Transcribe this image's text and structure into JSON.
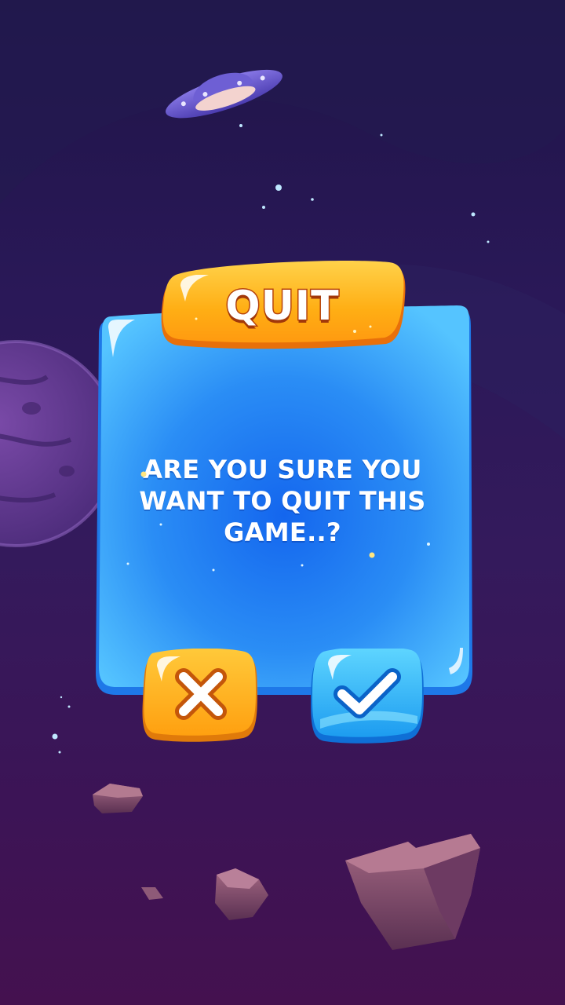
{
  "dialog": {
    "title": "QUIT",
    "message_lines": [
      "ARE YOU SURE YOU",
      "WANT TO QUIT THIS",
      "GAME..?"
    ]
  },
  "buttons": {
    "cancel": {
      "icon": "close-icon",
      "color": "#ffb21e"
    },
    "confirm": {
      "icon": "checkmark-icon",
      "color": "#2fb6f5"
    }
  },
  "colors": {
    "panel": "#2a8df5",
    "title_banner": "#ffae14",
    "background_top": "#1f1548",
    "background_bottom": "#44114f"
  }
}
